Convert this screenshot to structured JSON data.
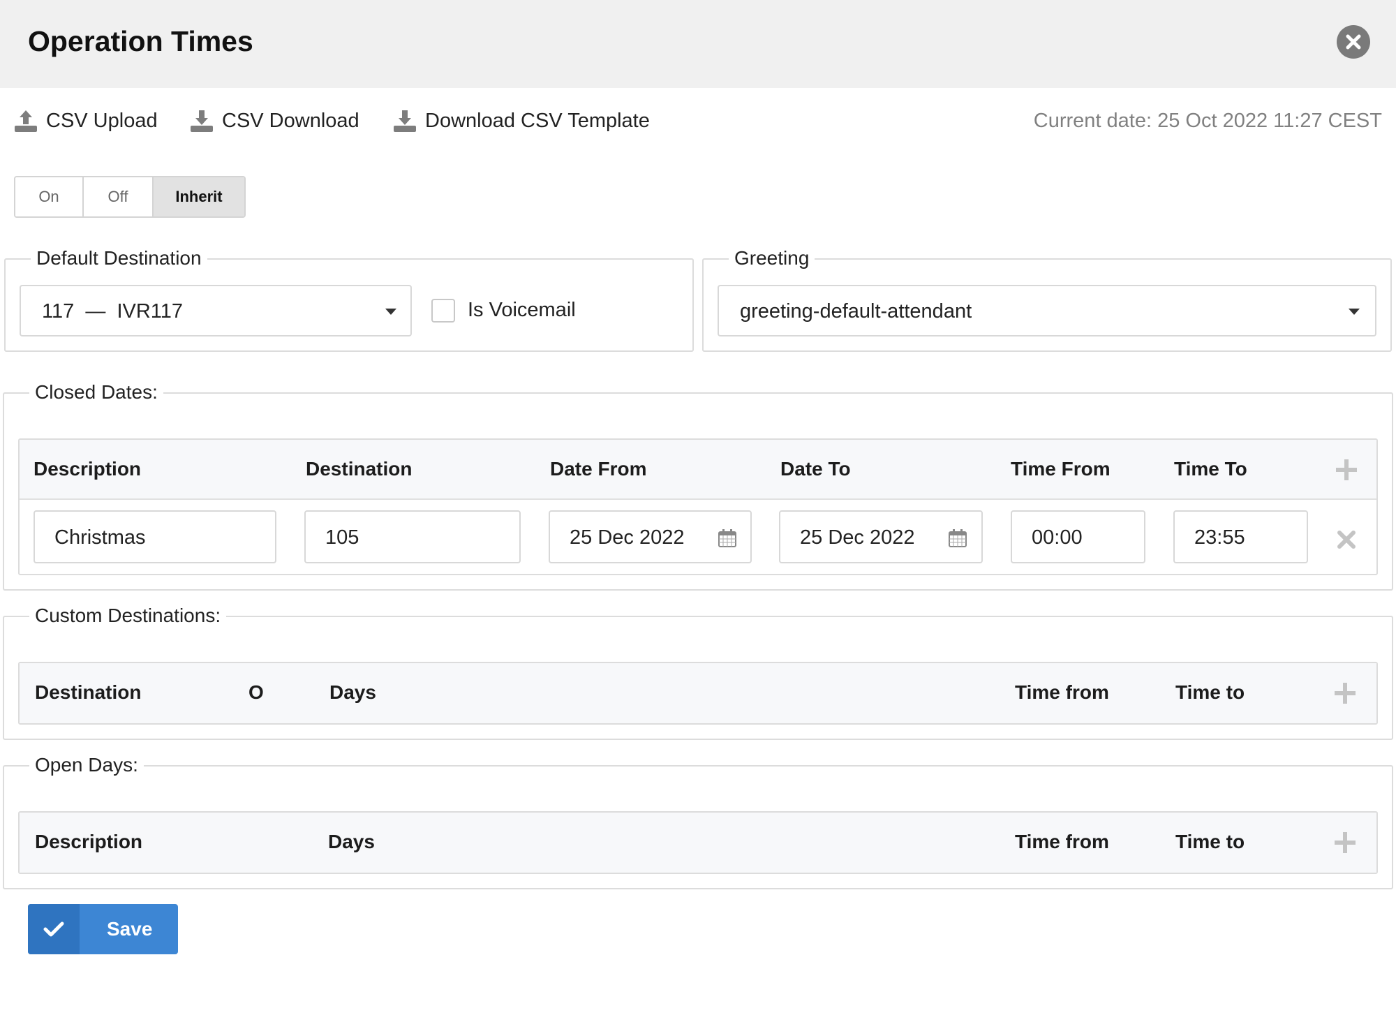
{
  "header": {
    "title": "Operation Times"
  },
  "toolbar": {
    "csv_upload": "CSV Upload",
    "csv_download": "CSV Download",
    "download_template": "Download CSV Template",
    "current_date": "Current date: 25 Oct 2022 11:27 CEST"
  },
  "mode_toggle": {
    "options": [
      "On",
      "Off",
      "Inherit"
    ],
    "selected": "Inherit"
  },
  "default_destination": {
    "legend": "Default Destination",
    "value": "117  —  IVR117",
    "voicemail_label": "Is Voicemail",
    "voicemail_checked": false
  },
  "greeting": {
    "legend": "Greeting",
    "value": "greeting-default-attendant"
  },
  "closed_dates": {
    "legend": "Closed Dates:",
    "headers": [
      "Description",
      "Destination",
      "Date From",
      "Date To",
      "Time From",
      "Time To"
    ],
    "rows": [
      {
        "description": "Christmas",
        "destination": "105",
        "date_from": "25 Dec 2022",
        "date_to": "25 Dec 2022",
        "time_from": "00:00",
        "time_to": "23:55"
      }
    ]
  },
  "custom_destinations": {
    "legend": "Custom Destinations:",
    "headers": [
      "Destination",
      "O",
      "Days",
      "Time from",
      "Time to"
    ]
  },
  "open_days": {
    "legend": "Open Days:",
    "headers": [
      "Description",
      "Days",
      "Time from",
      "Time to"
    ]
  },
  "actions": {
    "save_label": "Save"
  },
  "colors": {
    "primary": "#3d86d4",
    "header_bg": "#f0f0f0",
    "muted_text": "#808080"
  }
}
